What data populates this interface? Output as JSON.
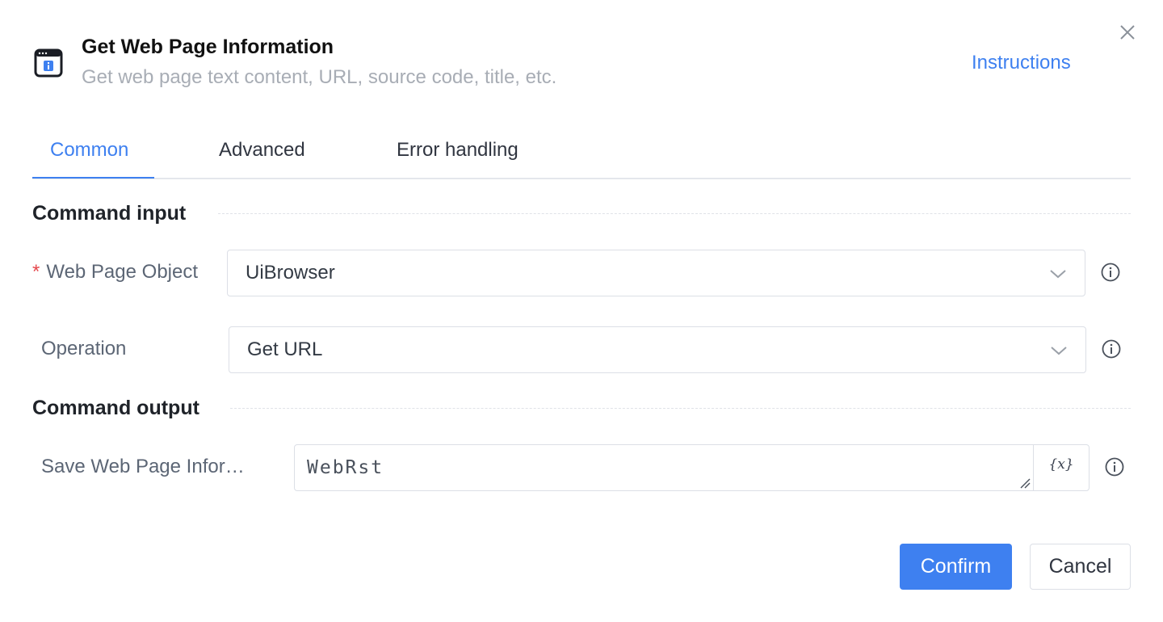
{
  "header": {
    "title": "Get Web Page Information",
    "subtitle": "Get web page text content, URL, source code, title, etc.",
    "instructions_label": "Instructions",
    "icon": "browser-info-icon"
  },
  "tabs": [
    {
      "label": "Common",
      "active": true
    },
    {
      "label": "Advanced",
      "active": false
    },
    {
      "label": "Error handling",
      "active": false
    }
  ],
  "command_input": {
    "section_title": "Command input",
    "fields": [
      {
        "label": "Web Page Object",
        "required_mark": "*",
        "value": "UiBrowser"
      },
      {
        "label": "Operation",
        "value": "Get URL"
      }
    ]
  },
  "command_output": {
    "section_title": "Command output",
    "save_label": "Save Web Page Infor…",
    "save_value": "WebRst",
    "variable_button": "{x}"
  },
  "footer": {
    "confirm_label": "Confirm",
    "cancel_label": "Cancel"
  },
  "colors": {
    "accent": "#3e80f0",
    "required": "#e5484d",
    "muted_text": "#a8adb5"
  }
}
